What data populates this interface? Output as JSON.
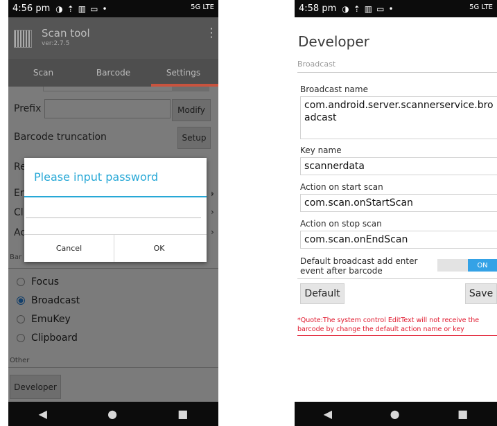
{
  "left": {
    "status": {
      "time": "4:56 pm",
      "network": "5G LTE"
    },
    "app": {
      "title": "Scan tool",
      "version": "ver:2.7.5"
    },
    "tabs": [
      {
        "label": "Scan"
      },
      {
        "label": "Barcode"
      },
      {
        "label": "Settings"
      }
    ],
    "prefix_label": "Prefix",
    "modify_button": "Modify",
    "truncation_label": "Barcode truncation",
    "setup_button": "Setup",
    "modes": [
      {
        "label": "Focus",
        "selected": false
      },
      {
        "label": "Broadcast",
        "selected": true
      },
      {
        "label": "EmuKey",
        "selected": false
      },
      {
        "label": "Clipboard",
        "selected": false
      }
    ],
    "section_other": "Other",
    "developer_button": "Developer",
    "dialog": {
      "title": "Please input password",
      "cancel": "Cancel",
      "ok": "OK"
    },
    "partial": {
      "re": "Re",
      "en": "En",
      "cl": "Cl",
      "ac": "Ac",
      "bar": "Bar"
    }
  },
  "right": {
    "status": {
      "time": "4:58 pm",
      "network": "5G LTE"
    },
    "title": "Developer",
    "section": "Broadcast",
    "broadcast_name_label": "Broadcast name",
    "broadcast_name_value": "com.android.server.scannerservice.broadcast",
    "key_name_label": "Key name",
    "key_name_value": "scannerdata",
    "start_label": "Action on start scan",
    "start_value": "com.scan.onStartScan",
    "stop_label": "Action on stop scan",
    "stop_value": "com.scan.onEndScan",
    "enter_label": "Default broadcast add enter event after barcode",
    "toggle_state": "ON",
    "default_button": "Default",
    "save_button": "Save",
    "note": "*Quote:The system control EditText will not receive the barcode by change the default action name or key"
  },
  "colors": {
    "accent_blue": "#27a8d6",
    "toggle_blue": "#34a2e6",
    "tab_indicator": "#c8533e",
    "note_red": "#e0162b"
  }
}
